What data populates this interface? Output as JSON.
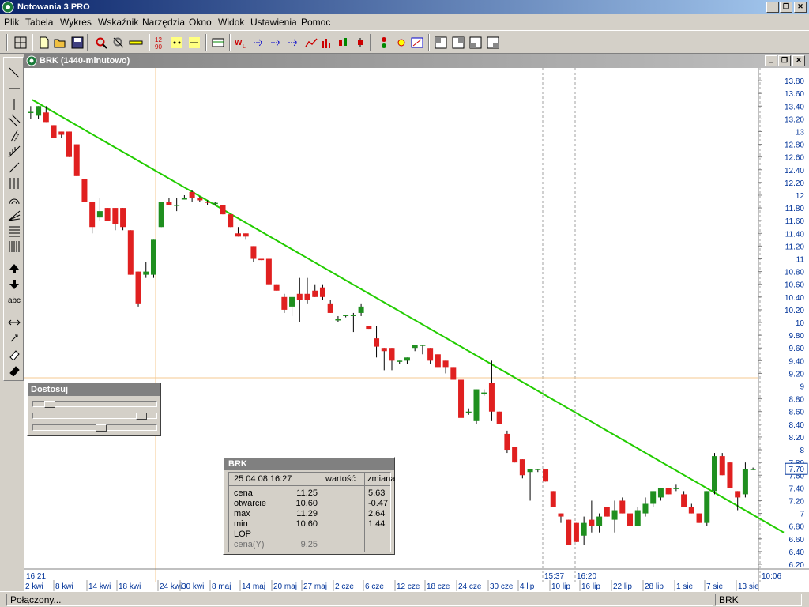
{
  "window": {
    "title": "Notowania 3 PRO"
  },
  "menu": [
    "Plik",
    "Tabela",
    "Wykres",
    "Wskaźnik",
    "Narzędzia",
    "Okno",
    "Widok",
    "Ustawienia",
    "Pomoc"
  ],
  "toolbar": {
    "icons": [
      "grid-icon",
      "new-file-icon",
      "open-folder-icon",
      "save-icon",
      "zoom-icon",
      "zoom-fit-icon",
      "ruler-icon",
      "number-icon",
      "dot-grid-icon",
      "dot-grid-2-icon",
      "table-icon",
      "wl-icon",
      "arrow-dots-icon",
      "arrow-dots-2-icon",
      "arrow-dots-3-icon",
      "line-chart-icon",
      "bar-chart-icon",
      "candle-icon",
      "ohlc-icon",
      "traffic-light-icon",
      "pointer-star-icon",
      "marker-icon",
      "layout-1-icon",
      "layout-2-icon",
      "layout-3-icon",
      "layout-4-icon"
    ]
  },
  "lefttools": {
    "icons": [
      "diagonal-line-icon",
      "horizontal-line-icon",
      "vertical-line-icon",
      "parallel-lines-icon",
      "channel-icon",
      "fibonacci-fan-icon",
      "slanted-line-icon",
      "vertical-lines-icon",
      "arcs-icon",
      "fan-icon",
      "horizontal-levels-icon",
      "time-zones-icon",
      "arrow-up-icon",
      "arrow-down-icon",
      "text-icon",
      "horizontal-arrows-icon",
      "shrink-icon",
      "eraser-icon",
      "eraser-all-icon"
    ],
    "text_label": "abc"
  },
  "chart_window": {
    "title": "BRK (1440-minutowo)"
  },
  "chart_data": {
    "type": "candlestick",
    "symbol": "BRK",
    "y_ticks": [
      "13.80",
      "13.60",
      "13.40",
      "13.20",
      "13",
      "12.80",
      "12.60",
      "12.40",
      "12.20",
      "12",
      "11.80",
      "11.60",
      "11.40",
      "11.20",
      "11",
      "10.80",
      "10.60",
      "10.40",
      "10.20",
      "10",
      "9.80",
      "9.60",
      "9.40",
      "9.20",
      "9",
      "8.80",
      "8.60",
      "8.40",
      "8.20",
      "8",
      "7.80",
      "7.60",
      "7.40",
      "7.20",
      "7",
      "6.80",
      "6.60",
      "6.40",
      "6.20"
    ],
    "ylim": [
      6.2,
      13.85
    ],
    "x_labels": [
      "2 kwi",
      "8 kwi",
      "14 kwi",
      "18 kwi",
      "24 kwi",
      "30 kwi",
      "8 maj",
      "14 maj",
      "20 maj",
      "27 maj",
      "2 cze",
      "6 cze",
      "12 cze",
      "18 cze",
      "24 cze",
      "30 cze",
      "4 lip",
      "10 lip",
      "16 lip",
      "22 lip",
      "28 lip",
      "1 sie",
      "7 sie",
      "13 sie"
    ],
    "time_labels": [
      "16:21",
      "15:37",
      "16:20",
      "10:06"
    ],
    "last_price": "7.70",
    "candles": [
      {
        "o": 13.31,
        "h": 13.4,
        "l": 13.2,
        "c": 13.31
      },
      {
        "o": 13.25,
        "h": 13.4,
        "l": 13.2,
        "c": 13.4
      },
      {
        "o": 13.3,
        "h": 13.4,
        "l": 13.15,
        "c": 13.15
      },
      {
        "o": 13.1,
        "h": 13.1,
        "l": 12.9,
        "c": 12.9
      },
      {
        "o": 13.0,
        "h": 13.0,
        "l": 12.9,
        "c": 12.95
      },
      {
        "o": 13.0,
        "h": 13.0,
        "l": 12.6,
        "c": 12.6
      },
      {
        "o": 12.8,
        "h": 12.8,
        "l": 12.3,
        "c": 12.3
      },
      {
        "o": 12.25,
        "h": 12.25,
        "l": 11.9,
        "c": 11.9
      },
      {
        "o": 11.9,
        "h": 11.9,
        "l": 11.4,
        "c": 11.5
      },
      {
        "o": 11.65,
        "h": 11.95,
        "l": 11.6,
        "c": 11.75
      },
      {
        "o": 11.8,
        "h": 11.8,
        "l": 11.6,
        "c": 11.6
      },
      {
        "o": 11.8,
        "h": 11.8,
        "l": 11.45,
        "c": 11.55
      },
      {
        "o": 11.8,
        "h": 11.8,
        "l": 11.45,
        "c": 11.5
      },
      {
        "o": 11.45,
        "h": 11.45,
        "l": 10.75,
        "c": 10.75
      },
      {
        "o": 10.8,
        "h": 10.8,
        "l": 10.25,
        "c": 10.3
      },
      {
        "o": 10.75,
        "h": 10.95,
        "l": 10.7,
        "c": 10.8
      },
      {
        "o": 10.75,
        "h": 11.3,
        "l": 10.7,
        "c": 11.3
      },
      {
        "o": 11.5,
        "h": 11.9,
        "l": 11.5,
        "c": 11.9
      },
      {
        "o": 11.9,
        "h": 11.95,
        "l": 11.85,
        "c": 11.85
      },
      {
        "o": 11.85,
        "h": 11.95,
        "l": 11.75,
        "c": 11.85
      },
      {
        "o": 11.95,
        "h": 12.0,
        "l": 11.95,
        "c": 11.95
      },
      {
        "o": 12.05,
        "h": 12.08,
        "l": 11.9,
        "c": 11.95
      },
      {
        "o": 11.95,
        "h": 11.98,
        "l": 11.9,
        "c": 11.92
      },
      {
        "o": 11.9,
        "h": 11.92,
        "l": 11.85,
        "c": 11.88
      },
      {
        "o": 11.88,
        "h": 11.9,
        "l": 11.85,
        "c": 11.88
      },
      {
        "o": 11.85,
        "h": 11.85,
        "l": 11.7,
        "c": 11.7
      },
      {
        "o": 11.7,
        "h": 11.7,
        "l": 11.5,
        "c": 11.5
      },
      {
        "o": 11.4,
        "h": 11.5,
        "l": 11.35,
        "c": 11.35
      },
      {
        "o": 11.4,
        "h": 11.4,
        "l": 11.3,
        "c": 11.35
      },
      {
        "o": 11.2,
        "h": 11.2,
        "l": 10.95,
        "c": 11.0
      },
      {
        "o": 11.0,
        "h": 11.0,
        "l": 10.98,
        "c": 10.98
      },
      {
        "o": 11.0,
        "h": 11.0,
        "l": 10.6,
        "c": 10.6
      },
      {
        "o": 10.6,
        "h": 10.6,
        "l": 10.5,
        "c": 10.5
      },
      {
        "o": 10.4,
        "h": 10.45,
        "l": 10.15,
        "c": 10.2
      },
      {
        "o": 10.25,
        "h": 10.4,
        "l": 10.1,
        "c": 10.4
      },
      {
        "o": 10.45,
        "h": 10.7,
        "l": 10.0,
        "c": 10.35
      },
      {
        "o": 10.45,
        "h": 10.7,
        "l": 10.3,
        "c": 10.35
      },
      {
        "o": 10.5,
        "h": 10.6,
        "l": 10.4,
        "c": 10.4
      },
      {
        "o": 10.55,
        "h": 10.6,
        "l": 10.35,
        "c": 10.4
      },
      {
        "o": 10.3,
        "h": 10.35,
        "l": 10.15,
        "c": 10.15
      },
      {
        "o": 10.05,
        "h": 10.1,
        "l": 10.0,
        "c": 10.05
      },
      {
        "o": 10.1,
        "h": 10.12,
        "l": 10.08,
        "c": 10.12
      },
      {
        "o": 10.1,
        "h": 10.15,
        "l": 9.85,
        "c": 10.12
      },
      {
        "o": 10.15,
        "h": 10.3,
        "l": 10.1,
        "c": 10.25
      },
      {
        "o": 9.95,
        "h": 9.95,
        "l": 9.9,
        "c": 9.9
      },
      {
        "o": 9.75,
        "h": 9.95,
        "l": 9.45,
        "c": 9.62
      },
      {
        "o": 9.6,
        "h": 9.6,
        "l": 9.25,
        "c": 9.55
      },
      {
        "o": 9.6,
        "h": 9.6,
        "l": 9.25,
        "c": 9.4
      },
      {
        "o": 9.4,
        "h": 9.4,
        "l": 9.35,
        "c": 9.4
      },
      {
        "o": 9.4,
        "h": 9.45,
        "l": 9.35,
        "c": 9.45
      },
      {
        "o": 9.6,
        "h": 9.65,
        "l": 9.55,
        "c": 9.65
      },
      {
        "o": 9.65,
        "h": 9.65,
        "l": 9.5,
        "c": 9.65
      },
      {
        "o": 9.6,
        "h": 9.6,
        "l": 9.35,
        "c": 9.4
      },
      {
        "o": 9.5,
        "h": 9.5,
        "l": 9.3,
        "c": 9.3
      },
      {
        "o": 9.4,
        "h": 9.4,
        "l": 9.2,
        "c": 9.3
      },
      {
        "o": 9.3,
        "h": 9.3,
        "l": 9.1,
        "c": 9.1
      },
      {
        "o": 9.1,
        "h": 9.1,
        "l": 8.5,
        "c": 8.5
      },
      {
        "o": 8.6,
        "h": 8.65,
        "l": 8.55,
        "c": 8.6
      },
      {
        "o": 8.45,
        "h": 8.95,
        "l": 8.4,
        "c": 8.95
      },
      {
        "o": 8.9,
        "h": 8.95,
        "l": 8.85,
        "c": 8.9
      },
      {
        "o": 9.05,
        "h": 9.4,
        "l": 8.45,
        "c": 8.6
      },
      {
        "o": 8.6,
        "h": 8.6,
        "l": 8.4,
        "c": 8.4
      },
      {
        "o": 8.25,
        "h": 8.3,
        "l": 7.95,
        "c": 8.0
      },
      {
        "o": 8.05,
        "h": 8.05,
        "l": 7.8,
        "c": 7.8
      },
      {
        "o": 7.85,
        "h": 7.85,
        "l": 7.55,
        "c": 7.6
      },
      {
        "o": 7.65,
        "h": 7.7,
        "l": 7.2,
        "c": 7.7
      },
      {
        "o": 7.7,
        "h": 7.7,
        "l": 7.65,
        "c": 7.7
      },
      {
        "o": 7.7,
        "h": 7.7,
        "l": 7.5,
        "c": 7.5
      },
      {
        "o": 7.35,
        "h": 7.35,
        "l": 7.1,
        "c": 7.1
      },
      {
        "o": 7.0,
        "h": 7.0,
        "l": 6.85,
        "c": 6.95
      },
      {
        "o": 6.9,
        "h": 6.9,
        "l": 6.5,
        "c": 6.5
      },
      {
        "o": 6.85,
        "h": 6.85,
        "l": 6.55,
        "c": 6.55
      },
      {
        "o": 6.65,
        "h": 6.95,
        "l": 6.5,
        "c": 6.85
      },
      {
        "o": 6.9,
        "h": 7.2,
        "l": 6.7,
        "c": 6.8
      },
      {
        "o": 6.8,
        "h": 7.0,
        "l": 6.7,
        "c": 6.95
      },
      {
        "o": 7.1,
        "h": 7.1,
        "l": 6.95,
        "c": 6.95
      },
      {
        "o": 6.9,
        "h": 7.2,
        "l": 6.7,
        "c": 7.05
      },
      {
        "o": 7.2,
        "h": 7.25,
        "l": 7.0,
        "c": 7.0
      },
      {
        "o": 7.0,
        "h": 7.0,
        "l": 6.8,
        "c": 6.8
      },
      {
        "o": 6.8,
        "h": 7.1,
        "l": 6.8,
        "c": 7.05
      },
      {
        "o": 7.0,
        "h": 7.25,
        "l": 6.95,
        "c": 7.15
      },
      {
        "o": 7.15,
        "h": 7.35,
        "l": 7.1,
        "c": 7.35
      },
      {
        "o": 7.25,
        "h": 7.4,
        "l": 7.2,
        "c": 7.4
      },
      {
        "o": 7.4,
        "h": 7.4,
        "l": 7.3,
        "c": 7.3
      },
      {
        "o": 7.4,
        "h": 7.45,
        "l": 7.35,
        "c": 7.4
      },
      {
        "o": 7.3,
        "h": 7.35,
        "l": 7.1,
        "c": 7.1
      },
      {
        "o": 7.1,
        "h": 7.15,
        "l": 7.0,
        "c": 7.0
      },
      {
        "o": 7.0,
        "h": 7.0,
        "l": 6.85,
        "c": 6.85
      },
      {
        "o": 6.85,
        "h": 7.35,
        "l": 6.8,
        "c": 7.35
      },
      {
        "o": 7.35,
        "h": 7.95,
        "l": 7.3,
        "c": 7.9
      },
      {
        "o": 7.9,
        "h": 7.95,
        "l": 7.6,
        "c": 7.6
      },
      {
        "o": 7.8,
        "h": 7.8,
        "l": 7.4,
        "c": 7.4
      },
      {
        "o": 7.35,
        "h": 7.35,
        "l": 7.05,
        "c": 7.25
      },
      {
        "o": 7.3,
        "h": 7.8,
        "l": 7.25,
        "c": 7.7
      },
      {
        "o": 7.7,
        "h": 7.72,
        "l": 7.68,
        "c": 7.7
      }
    ],
    "trendline": {
      "from": {
        "x": "2 kwi",
        "y": 13.5
      },
      "to": {
        "x": "13 sie",
        "y": 6.7
      },
      "color": "#22cc00"
    },
    "colors": {
      "up": "#1f8f1f",
      "down": "#e02020",
      "axis_text": "#003399"
    }
  },
  "dostosuj": {
    "title": "Dostosuj",
    "sliders": [
      0.1,
      0.9,
      0.55
    ]
  },
  "infobox": {
    "title": "BRK",
    "date": "25 04 08 16:27",
    "col_wartosc": "wartość",
    "col_zmiana": "zmiana",
    "rows": [
      {
        "label": "cena",
        "value": "11.25",
        "change": "5.63"
      },
      {
        "label": "otwarcie",
        "value": "10.60",
        "change": "-0.47"
      },
      {
        "label": "max",
        "value": "11.29",
        "change": "2.64"
      },
      {
        "label": "min",
        "value": "10.60",
        "change": "1.44"
      },
      {
        "label": "LOP",
        "value": "",
        "change": ""
      },
      {
        "label": "cena(Y)",
        "value": "9.25",
        "change": ""
      }
    ]
  },
  "statusbar": {
    "left": "Połączony...",
    "right": "BRK"
  }
}
